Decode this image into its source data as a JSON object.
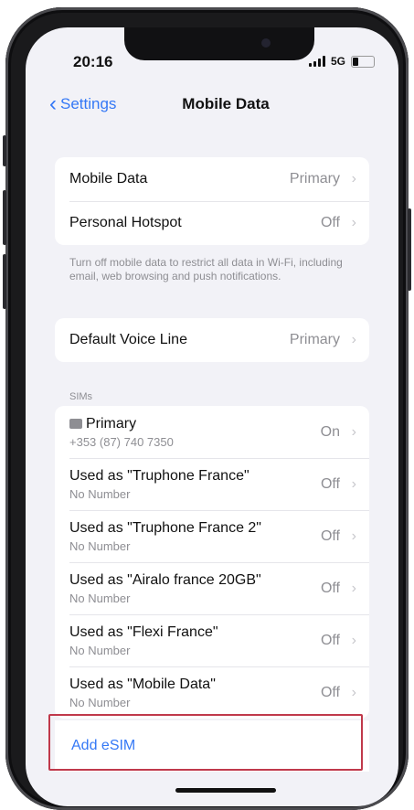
{
  "status_bar": {
    "time": "20:16",
    "network": "5G",
    "battery_level": 0.3
  },
  "nav": {
    "back_label": "Settings",
    "title": "Mobile Data"
  },
  "mobile_group": [
    {
      "label": "Mobile Data",
      "value": "Primary"
    },
    {
      "label": "Personal Hotspot",
      "value": "Off"
    }
  ],
  "mobile_footer": "Turn off mobile data to restrict all data in Wi-Fi, including email, web browsing and push notifications.",
  "voice_group": {
    "label": "Default Voice Line",
    "value": "Primary"
  },
  "sims_header": "SIMs",
  "sims": [
    {
      "label": "Primary",
      "sub": "+353 (87) 740 7350",
      "value": "On"
    },
    {
      "label": "Used as \"Truphone France\"",
      "sub": "No Number",
      "value": "Off"
    },
    {
      "label": "Used as \"Truphone France 2\"",
      "sub": "No Number",
      "value": "Off"
    },
    {
      "label": "Used as \"Airalo france 20GB\"",
      "sub": "No Number",
      "value": "Off"
    },
    {
      "label": "Used as \"Flexi France\"",
      "sub": "No Number",
      "value": "Off"
    },
    {
      "label": "Used as \"Mobile Data\"",
      "sub": "No Number",
      "value": "Off"
    }
  ],
  "add_esim_label": "Add eSIM",
  "colors": {
    "accent": "#3478f6",
    "highlight": "#c0394b"
  }
}
